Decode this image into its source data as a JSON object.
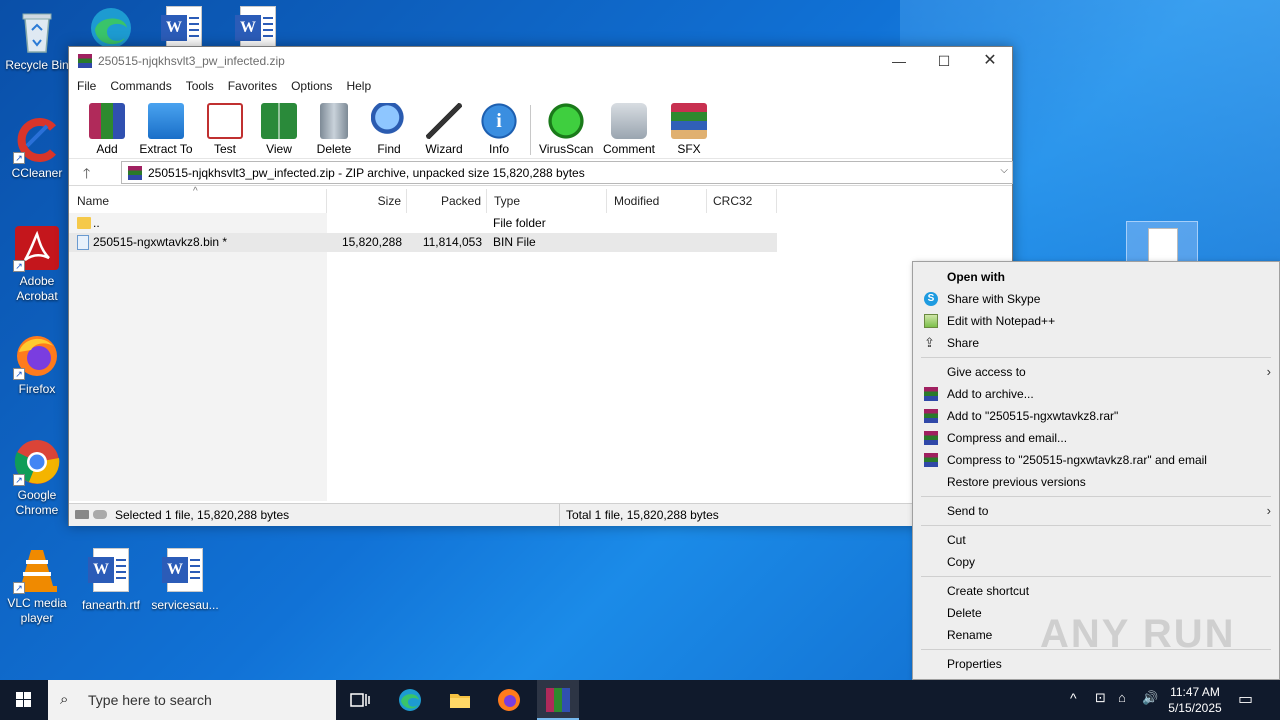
{
  "desktop": {
    "icons": [
      {
        "label": "Recycle Bin"
      },
      {
        "label": "CCleaner"
      },
      {
        "label": "Adobe Acrobat"
      },
      {
        "label": "Firefox"
      },
      {
        "label": "Google Chrome"
      },
      {
        "label": "VLC media player"
      },
      {
        "label": "fanearth.rtf"
      },
      {
        "label": "servicesau..."
      }
    ]
  },
  "winrar": {
    "title": "250515-njqkhsvlt3_pw_infected.zip",
    "menu": [
      "File",
      "Commands",
      "Tools",
      "Favorites",
      "Options",
      "Help"
    ],
    "toolbar": [
      {
        "label": "Add",
        "icon": "add-icon"
      },
      {
        "label": "Extract To",
        "icon": "extract-icon"
      },
      {
        "label": "Test",
        "icon": "test-icon"
      },
      {
        "label": "View",
        "icon": "view-icon"
      },
      {
        "label": "Delete",
        "icon": "delete-icon"
      },
      {
        "label": "Find",
        "icon": "find-icon"
      },
      {
        "label": "Wizard",
        "icon": "wizard-icon"
      },
      {
        "label": "Info",
        "icon": "info-icon"
      },
      {
        "label": "VirusScan",
        "icon": "virusscan-icon"
      },
      {
        "label": "Comment",
        "icon": "comment-icon"
      },
      {
        "label": "SFX",
        "icon": "sfx-icon"
      }
    ],
    "address": "250515-njqkhsvlt3_pw_infected.zip - ZIP archive, unpacked size 15,820,288 bytes",
    "columns": [
      "Name",
      "Size",
      "Packed",
      "Type",
      "Modified",
      "CRC32"
    ],
    "rows": [
      {
        "name": "..",
        "size": "",
        "packed": "",
        "type": "File folder"
      },
      {
        "name": "250515-ngxwtavkz8.bin *",
        "size": "15,820,288",
        "packed": "11,814,053",
        "type": "BIN File"
      }
    ],
    "status_left": "Selected 1 file, 15,820,288 bytes",
    "status_right": "Total 1 file, 15,820,288 bytes"
  },
  "context_menu": {
    "open_with": "Open with",
    "share_skype": "Share with Skype",
    "edit_notepad": "Edit with Notepad++",
    "share": "Share",
    "give_access": "Give access to",
    "add_archive": "Add to archive...",
    "add_rar": "Add to \"250515-ngxwtavkz8.rar\"",
    "compress_email": "Compress and email...",
    "compress_rar_email": "Compress to \"250515-ngxwtavkz8.rar\" and email",
    "restore": "Restore previous versions",
    "send_to": "Send to",
    "cut": "Cut",
    "copy": "Copy",
    "create_shortcut": "Create shortcut",
    "delete": "Delete",
    "rename": "Rename",
    "properties": "Properties"
  },
  "watermark": "ANY RUN",
  "taskbar": {
    "search_placeholder": "Type here to search",
    "time": "11:47 AM",
    "date": "5/15/2025"
  }
}
